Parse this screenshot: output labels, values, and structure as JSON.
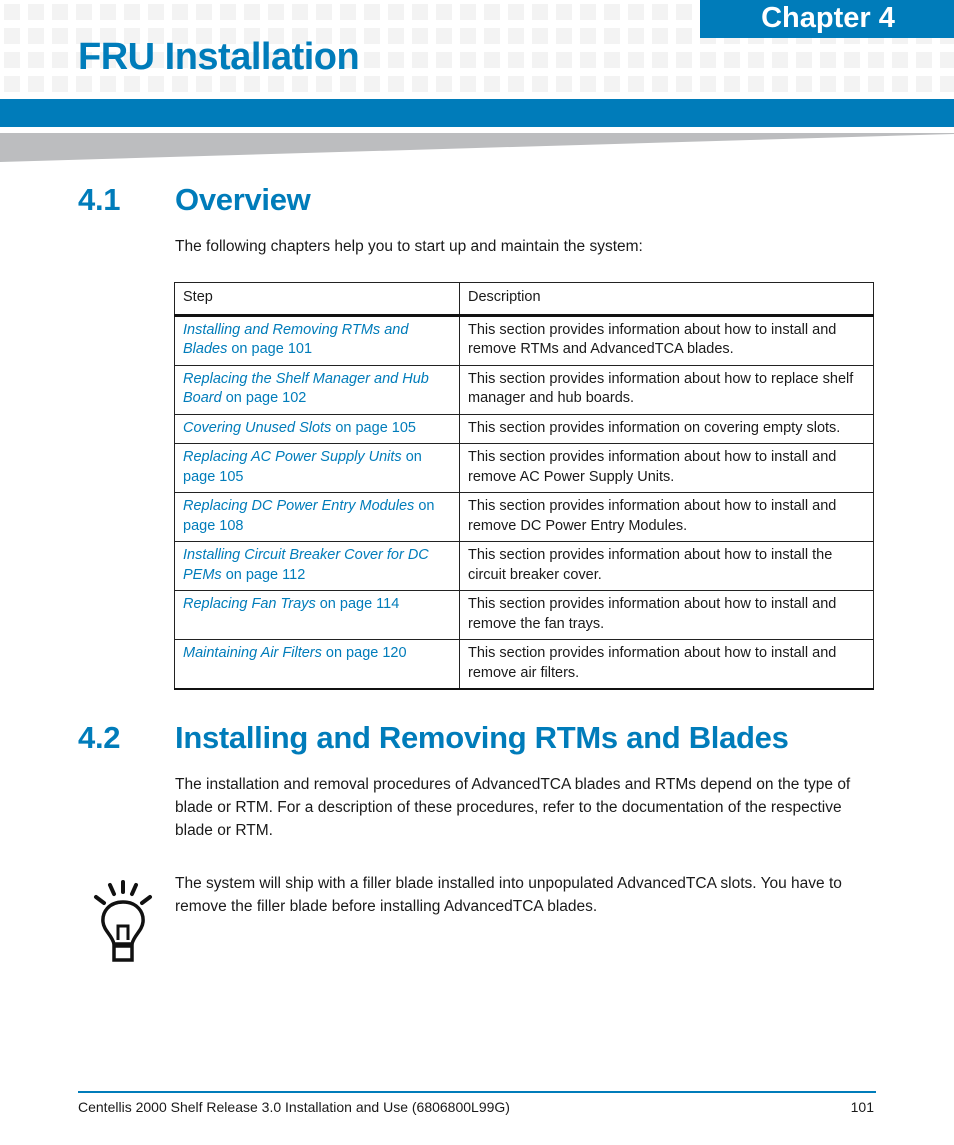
{
  "header": {
    "chapter_label": "Chapter 4",
    "chapter_title": "FRU Installation",
    "accent_color": "#007cba"
  },
  "section_4_1": {
    "number": "4.1",
    "title": "Overview",
    "intro": "The following chapters help you to start up and maintain the system:",
    "table": {
      "headers": [
        "Step",
        "Description"
      ],
      "rows": [
        {
          "link_title": "Installing and Removing RTMs and Blades",
          "link_suffix": " on page 101",
          "description": "This section provides information about how to install and remove RTMs and AdvancedTCA blades."
        },
        {
          "link_title": "Replacing the Shelf Manager and Hub Board",
          "link_suffix": " on page 102",
          "description": "This section provides information about how to replace shelf manager and hub boards."
        },
        {
          "link_title": "Covering Unused Slots",
          "link_suffix": " on page 105",
          "description": "This section provides information on covering empty slots."
        },
        {
          "link_title": "Replacing AC Power Supply Units",
          "link_suffix": " on page 105",
          "description": "This section provides information about how to install and remove AC Power Supply Units."
        },
        {
          "link_title": "Replacing DC Power Entry Modules",
          "link_suffix": " on page 108",
          "description": "This section provides information about how to install and remove DC Power Entry Modules."
        },
        {
          "link_title": "Installing Circuit Breaker Cover for DC PEMs",
          "link_suffix": " on page 112",
          "description": "This section provides information about how to install the circuit breaker cover."
        },
        {
          "link_title": "Replacing Fan Trays",
          "link_suffix": " on page 114",
          "description": "This section provides information about how to install and remove the fan trays."
        },
        {
          "link_title": "Maintaining Air Filters",
          "link_suffix": " on page 120",
          "description": "This section provides information about how to install and remove air filters."
        }
      ]
    }
  },
  "section_4_2": {
    "number": "4.2",
    "title": "Installing and Removing RTMs and Blades",
    "body": "The installation and removal procedures of AdvancedTCA blades and RTMs depend on the type of blade or RTM. For a description of these procedures, refer to the documentation of the respective blade or RTM.",
    "tip": {
      "icon": "lightbulb-icon",
      "text": "The system will ship with a filler blade installed into unpopulated AdvancedTCA slots. You have to remove the filler blade before installing AdvancedTCA blades."
    }
  },
  "footer": {
    "document_title": "Centellis 2000 Shelf Release 3.0 Installation and Use (6806800L99G)",
    "page_number": "101"
  }
}
